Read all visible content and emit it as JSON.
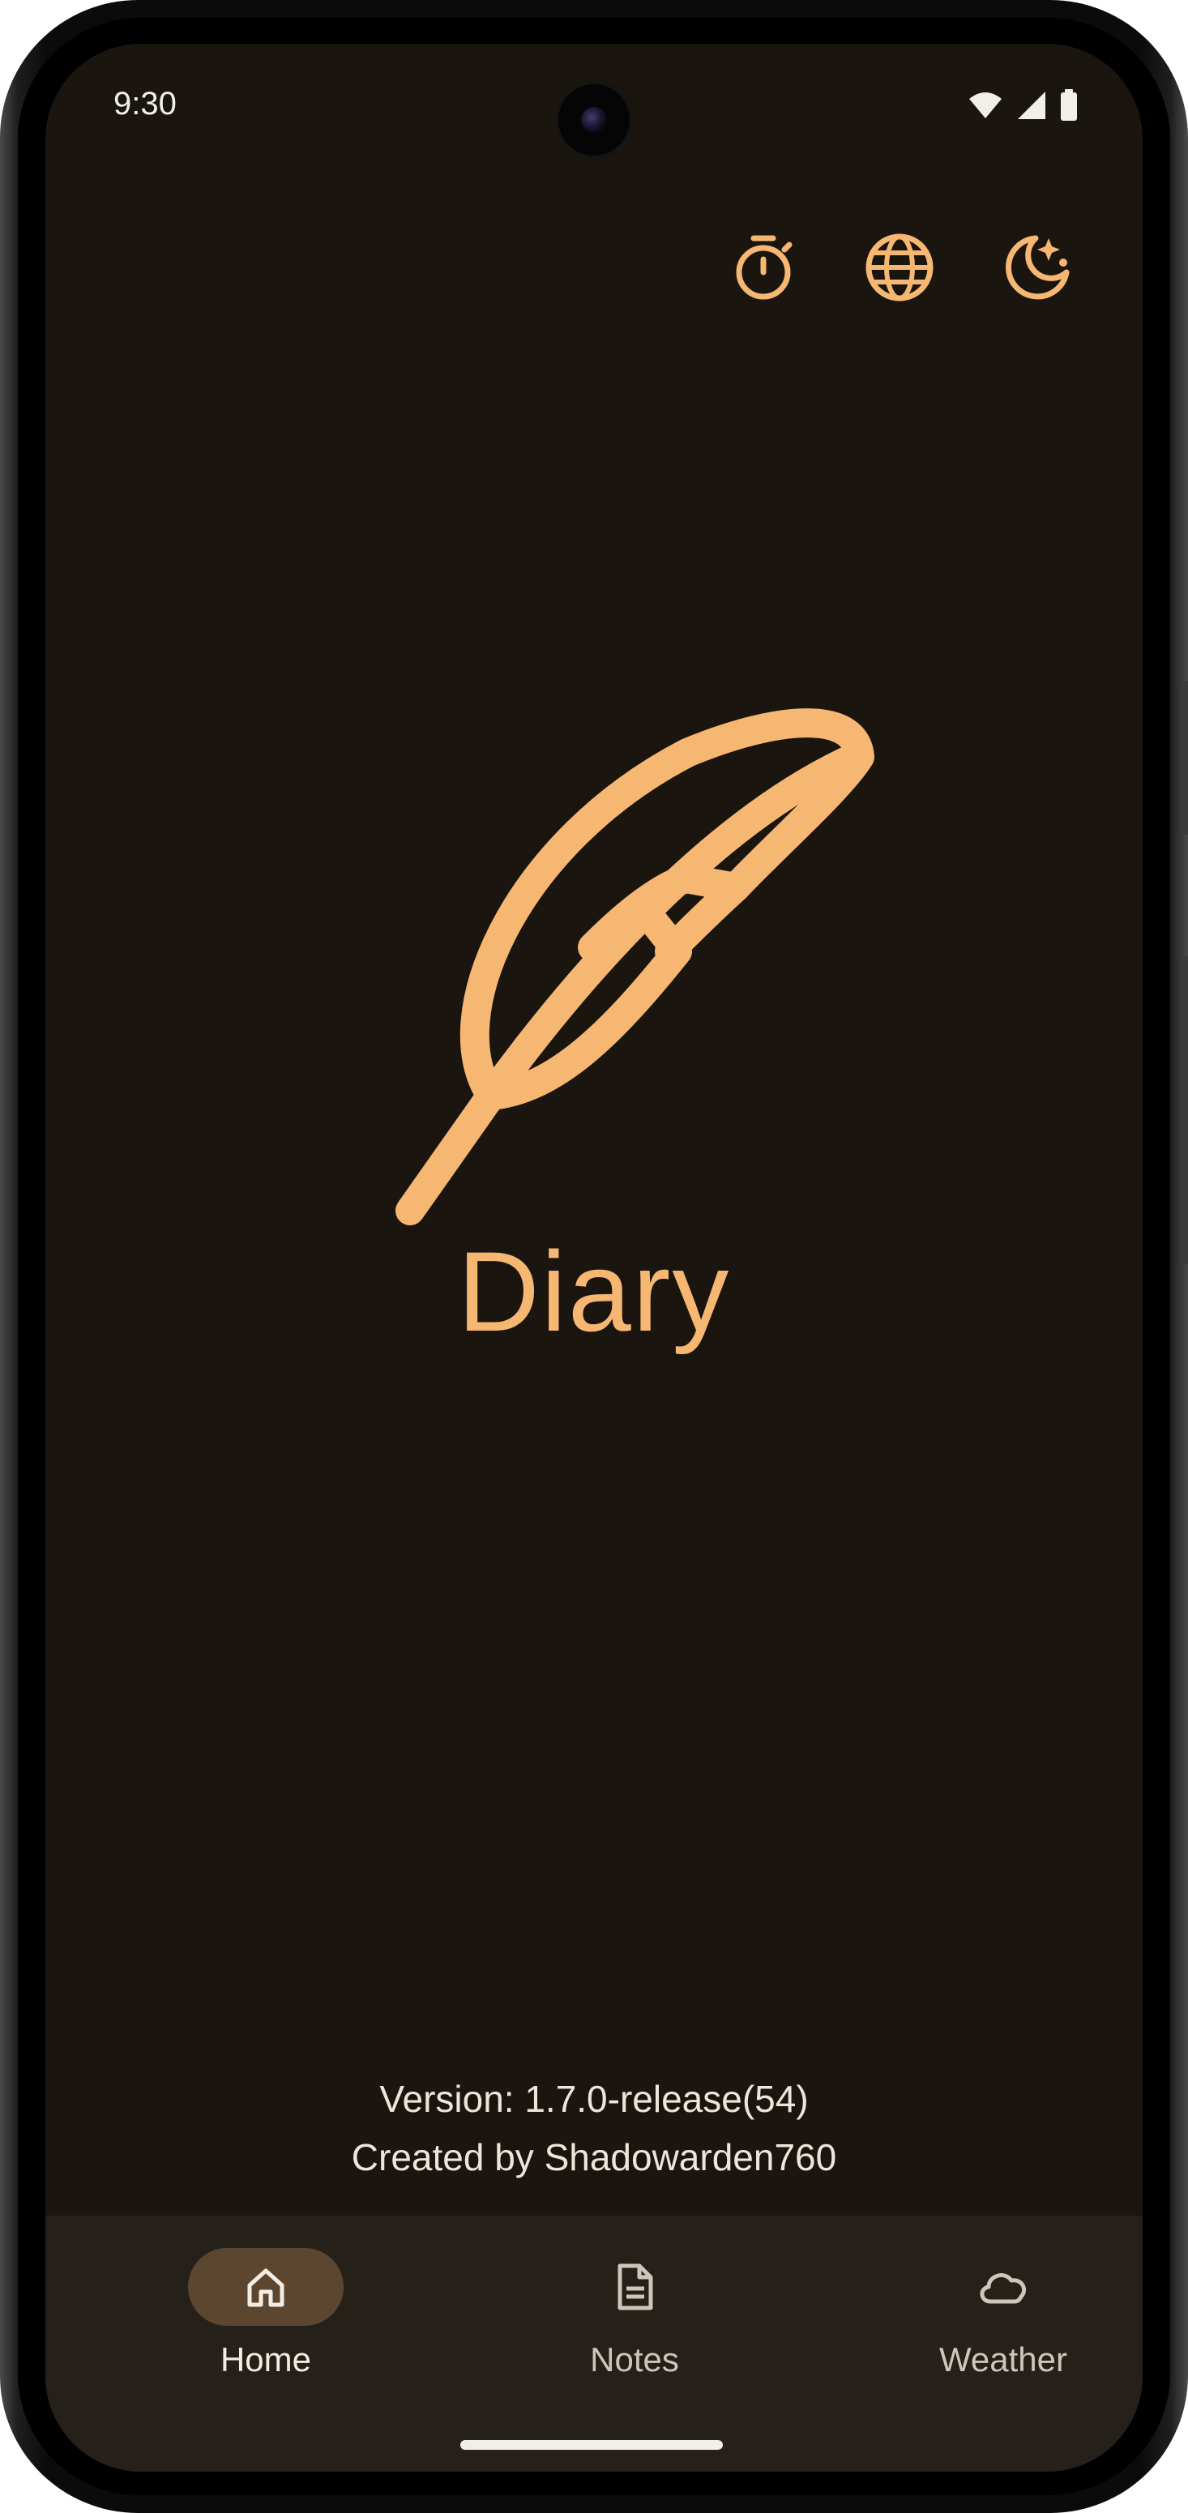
{
  "status_bar": {
    "time": "9:30",
    "icons": [
      "wifi-icon",
      "cellular-signal-icon",
      "battery-icon"
    ]
  },
  "top_actions": [
    {
      "name": "timer-icon"
    },
    {
      "name": "globe-icon"
    },
    {
      "name": "theme-night-icon"
    }
  ],
  "hero": {
    "logo_icon": "feather-icon",
    "title": "Diary"
  },
  "footer": {
    "version": "Version: 1.7.0-release(54)",
    "created_by": "Created by Shadowarden760"
  },
  "bottom_nav": {
    "items": [
      {
        "label": "Home",
        "icon": "home-icon",
        "active": true
      },
      {
        "label": "Notes",
        "icon": "document-icon",
        "active": false
      },
      {
        "label": "Weather",
        "icon": "cloud-icon",
        "active": false
      }
    ]
  },
  "colors": {
    "background": "#1a150f",
    "accent": "#f6b773",
    "nav_background": "#26201a",
    "nav_active_pill": "#5c4630",
    "text": "#ece6dc"
  }
}
